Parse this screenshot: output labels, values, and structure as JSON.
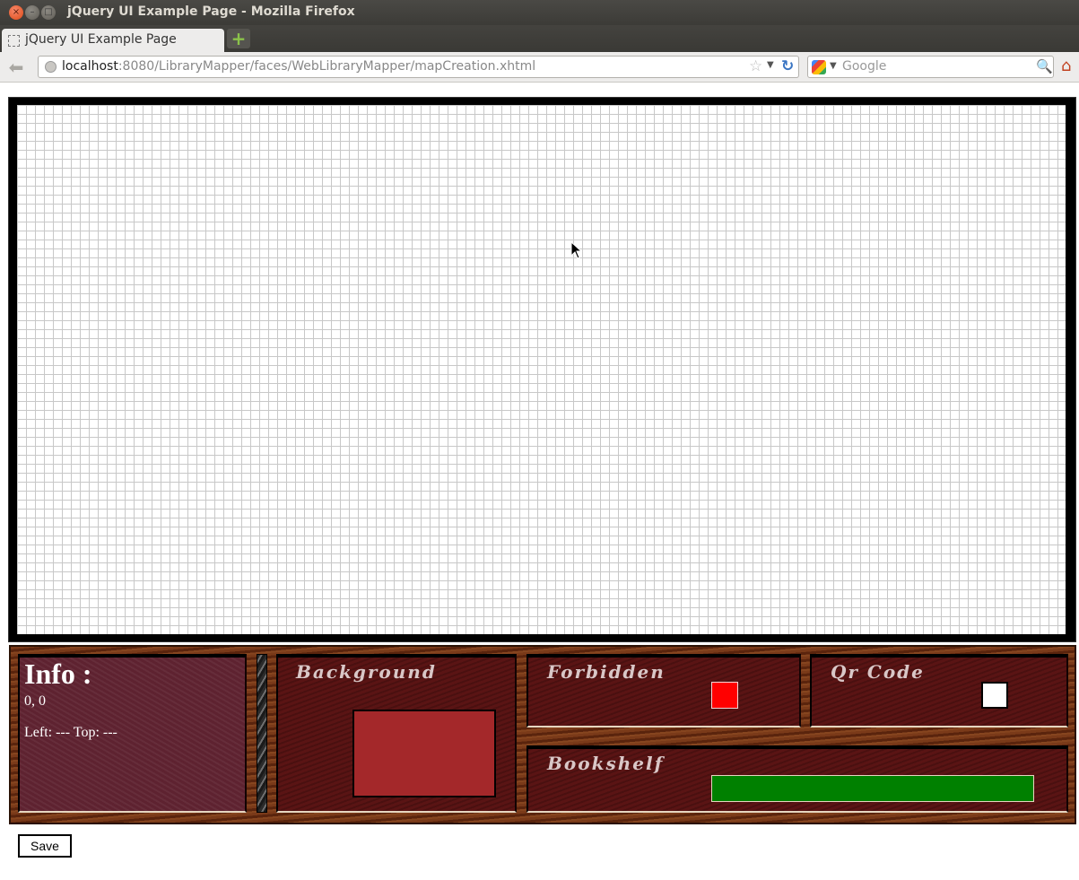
{
  "window": {
    "title": "jQuery UI Example Page - Mozilla Firefox",
    "close_glyph": "×",
    "minimize_glyph": "–",
    "maximize_glyph": "□"
  },
  "tabs": [
    {
      "label": "jQuery UI Example Page",
      "active": true
    }
  ],
  "new_tab_glyph": "+",
  "navbar": {
    "back_glyph": "⬅",
    "url_host": "localhost",
    "url_rest": ":8080/LibraryMapper/faces/WebLibraryMapper/mapCreation.xhtml",
    "bookmark_glyph": "☆",
    "dropdown_glyph": "▼",
    "reload_glyph": "↻",
    "search_placeholder": "Google",
    "search_glyph": "🔍",
    "home_glyph": "⌂"
  },
  "map": {
    "grid_color": "#c8c8c8"
  },
  "toolbox": {
    "info": {
      "title": "Info :",
      "coords": "0, 0",
      "position": "Left: --- Top: ---"
    },
    "background": {
      "title": "Background",
      "color": "#a4282a"
    },
    "forbidden": {
      "title": "Forbidden",
      "color": "#ff0000"
    },
    "qr_code": {
      "title": "Qr Code",
      "color": "#ffffff"
    },
    "bookshelf": {
      "title": "Bookshelf",
      "color": "#008000"
    }
  },
  "save_label": "Save"
}
